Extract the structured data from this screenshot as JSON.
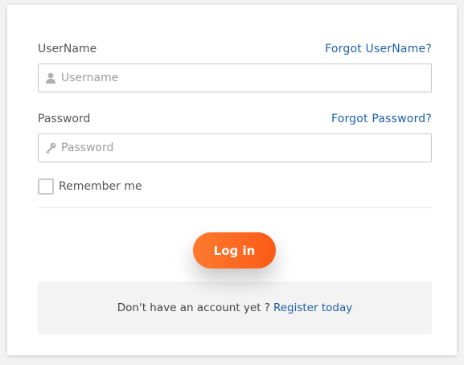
{
  "username": {
    "label": "UserName",
    "forgot_link": "Forgot UserName?",
    "placeholder": "Username",
    "value": "",
    "icon": "user-icon"
  },
  "password": {
    "label": "Password",
    "forgot_link": "Forgot Password?",
    "placeholder": "Password",
    "value": "",
    "icon": "key-icon"
  },
  "remember": {
    "label": "Remember me",
    "checked": false
  },
  "login_button": {
    "label": "Log in",
    "color": "#fb6a22"
  },
  "footer": {
    "text": "Don't have an account yet ?",
    "register_link": "Register today"
  },
  "colors": {
    "link": "#1f5fa8",
    "accent": "#fb6a22"
  }
}
